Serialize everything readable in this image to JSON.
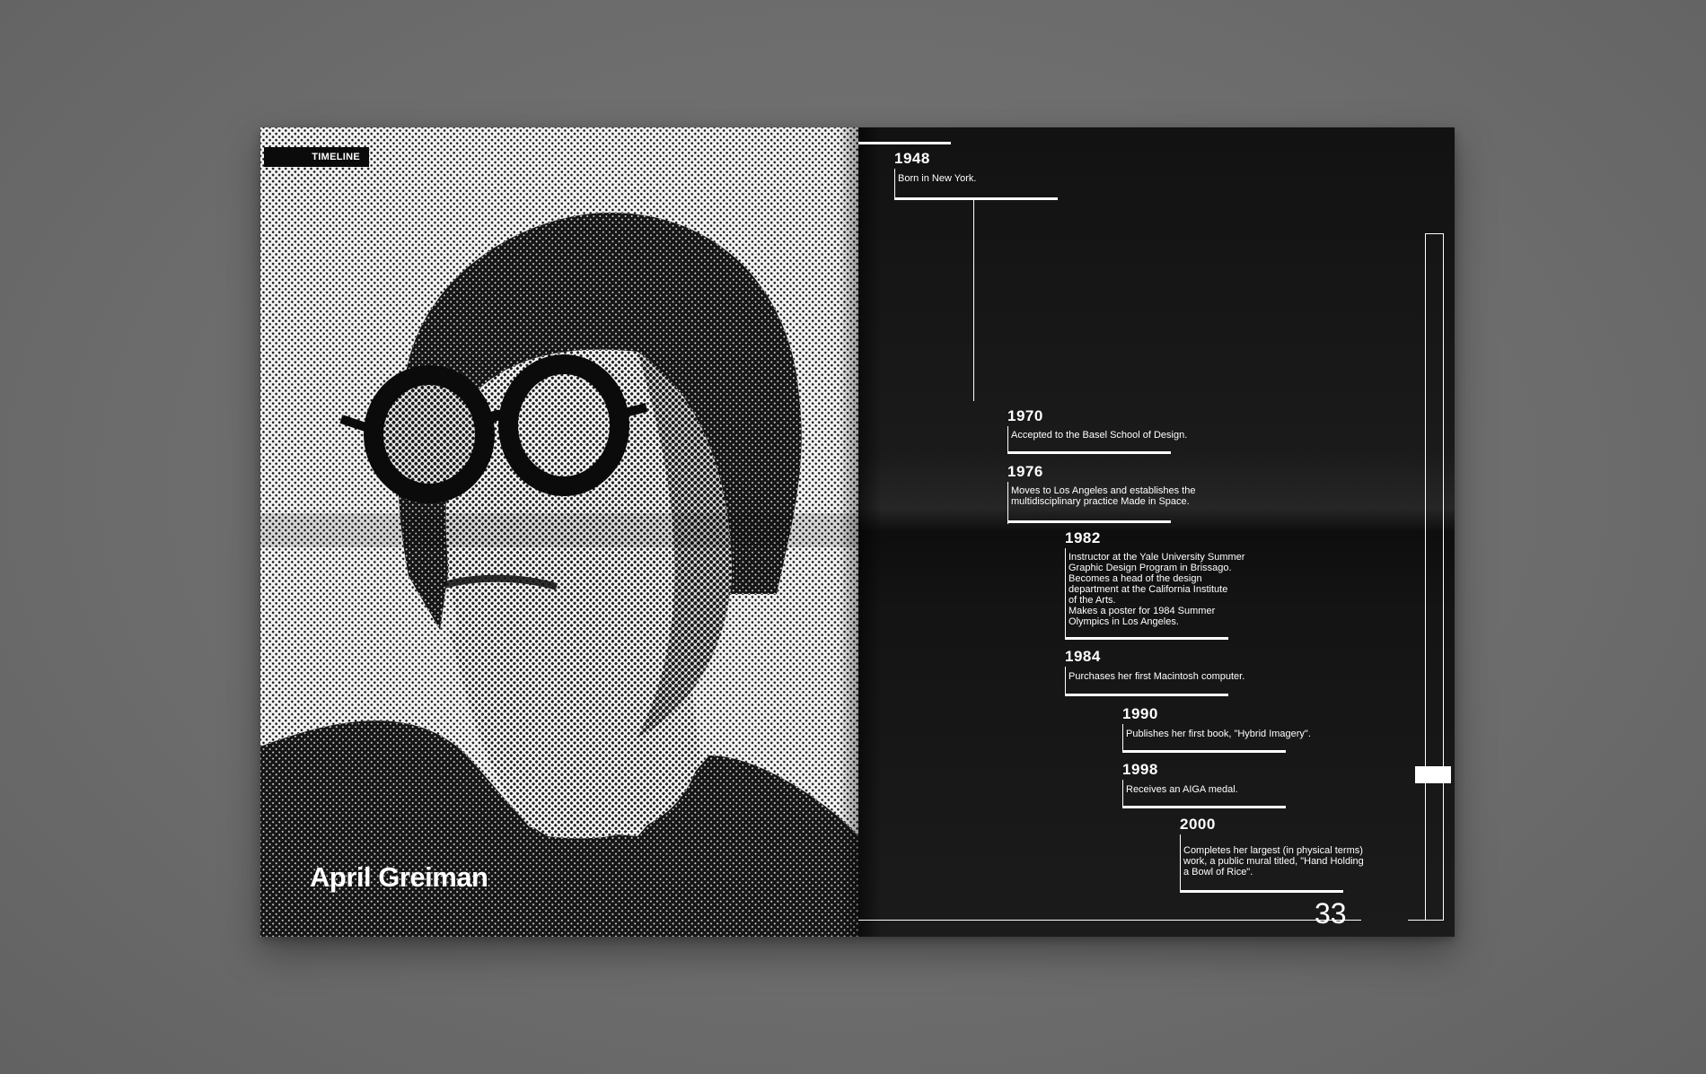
{
  "left_page": {
    "section_tag": "TIMELINE",
    "person_name": "April Greiman"
  },
  "right_page": {
    "page_number": "33",
    "timeline": [
      {
        "year": "1948",
        "text": "Born in New York."
      },
      {
        "year": "1970",
        "text": "Accepted to the Basel School of Design."
      },
      {
        "year": "1976",
        "text": "Moves to Los Angeles and establishes the\nmultidisciplinary practice Made in Space."
      },
      {
        "year": "1982",
        "text": "Instructor at the Yale University Summer\nGraphic Design Program in Brissago.\nBecomes a head of the design\ndepartment at the California Institute\nof the Arts.\nMakes a poster for 1984 Summer\nOlympics in Los Angeles."
      },
      {
        "year": "1984",
        "text": "Purchases her first Macintosh computer."
      },
      {
        "year": "1990",
        "text": "Publishes her first book, \"Hybrid Imagery\"."
      },
      {
        "year": "1998",
        "text": "Receives an AIGA medal."
      },
      {
        "year": "2000",
        "text": "Completes her largest (in physical terms)\nwork, a public mural titled, \"Hand Holding\na Bowl of Rice\"."
      }
    ]
  },
  "colors": {
    "background": "#6f6f6f",
    "page_dark": "#141414",
    "ink": "#ffffff"
  }
}
